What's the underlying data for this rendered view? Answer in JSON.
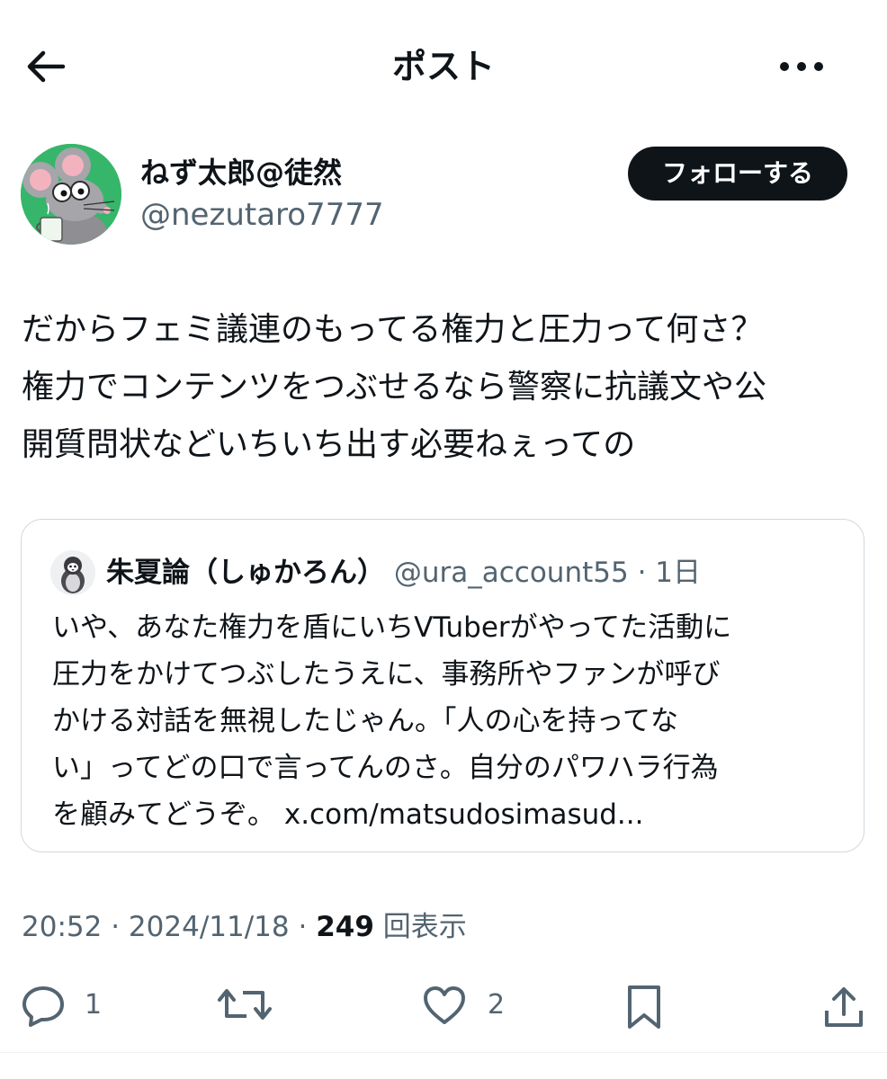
{
  "header": {
    "title": "ポスト"
  },
  "author": {
    "display_name": "ねず太郎@徒然",
    "handle": "@nezutaro7777"
  },
  "follow_button": {
    "label": "フォローする"
  },
  "tweet": {
    "lines": [
      "だからフェミ議連のもってる権力と圧力って何さ？",
      "権力でコンテンツをつぶせるなら警察に抗議文や公",
      "開質問状などいちいち出す必要ねぇっての"
    ]
  },
  "quoted": {
    "display_name": "朱夏論（しゅかろん）",
    "handle": "@ura_account55",
    "separator": "·",
    "time": "1日",
    "lines": [
      "いや、あなた権力を盾にいちVTuberがやってた活動に",
      "圧力をかけてつぶしたうえに、事務所やファンが呼び",
      "かける対話を無視したじゃん。「人の心を持ってな",
      "い」ってどの口で言ってんのさ。自分のパワハラ行為",
      "を顧みてどうぞ。 x.com/matsudosimasud..."
    ]
  },
  "meta": {
    "time": "20:52",
    "separator": "·",
    "date": "2024/11/18",
    "views_count": "249",
    "views_label": "回表示"
  },
  "actions": {
    "reply_count": "1",
    "like_count": "2"
  },
  "icons": {
    "back": "arrow-left-icon",
    "more": "more-dots-icon",
    "reply": "speech-bubble-icon",
    "retweet": "retweet-icon",
    "like": "heart-icon",
    "bookmark": "bookmark-icon",
    "share": "share-icon"
  },
  "colors": {
    "text": "#0f1419",
    "secondary": "#536471",
    "avatar_bg": "#36b66a",
    "button_bg": "#0f1419",
    "border": "#cfd9de"
  }
}
